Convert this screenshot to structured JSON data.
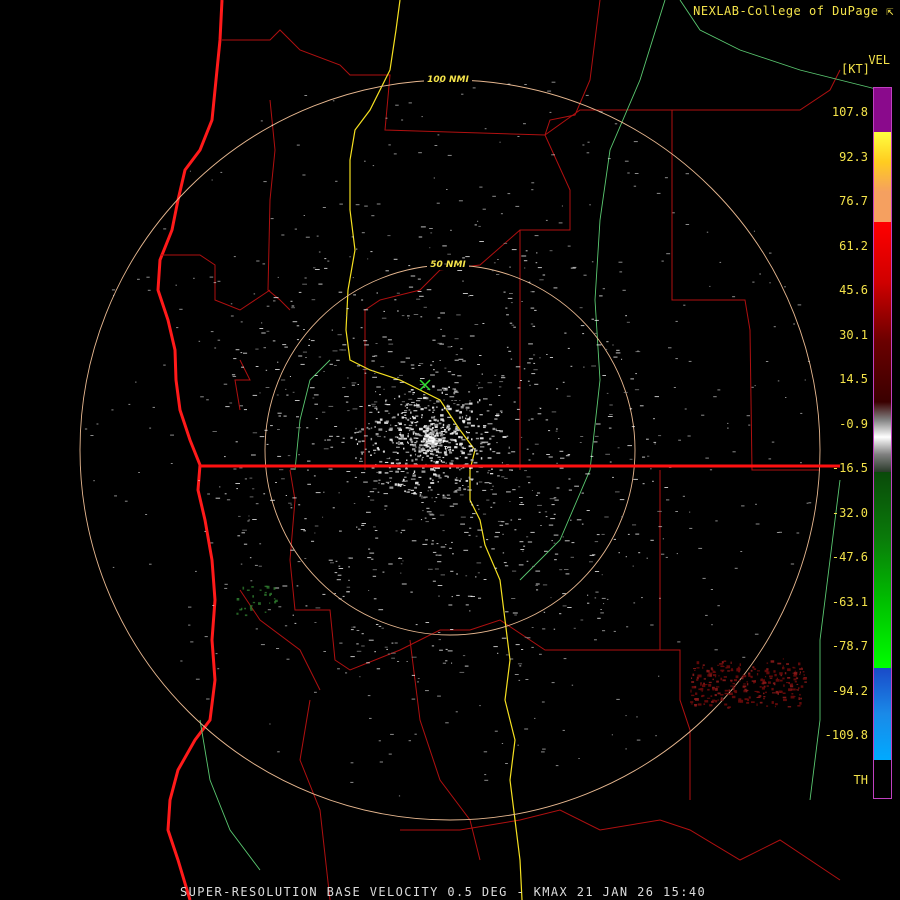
{
  "header": {
    "credit": "NEXLAB-College of DuPage",
    "credit_icon": "cursor-arrow-icon"
  },
  "rings": [
    {
      "label": "100 NMI"
    },
    {
      "label": "50 NMI"
    }
  ],
  "legend": {
    "title": "VEL",
    "unit": "[KT]",
    "labels": [
      "107.8",
      "92.3",
      "76.7",
      "61.2",
      "45.6",
      "30.1",
      "14.5",
      "-0.9",
      "-16.5",
      "-32.0",
      "-47.6",
      "-63.1",
      "-78.7",
      "-94.2",
      "-109.8",
      "TH"
    ],
    "colors": {
      "purple": "#8a0a8c",
      "yellow": "#ffff00",
      "orange": "#f5a060",
      "red": "#ff0000",
      "dark_red": "#3a0000",
      "gray": "#c8c8c8",
      "dark_green": "#0a4a0a",
      "green": "#00e000",
      "blue": "#1a6ad8",
      "light_blue": "#00aaff",
      "black": "#000000"
    }
  },
  "footer": {
    "caption": "SUPER-RESOLUTION BASE VELOCITY 0.5 DEG - KMAX 21 JAN 26 15:40"
  }
}
